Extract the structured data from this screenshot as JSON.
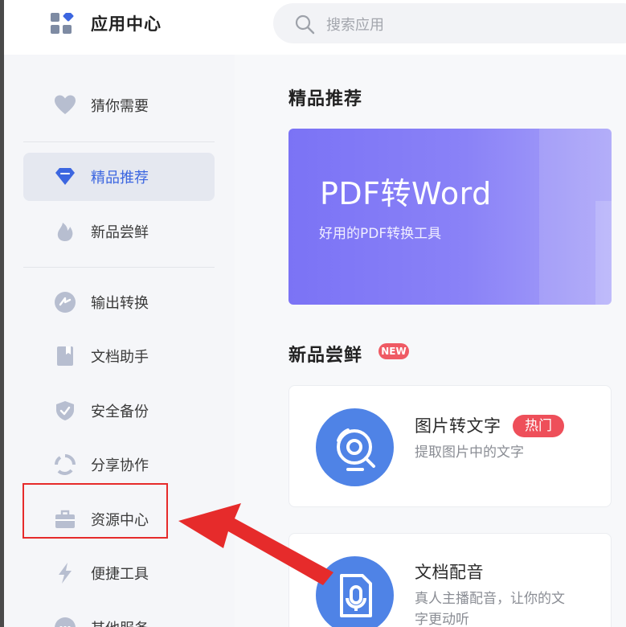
{
  "header": {
    "title": "应用中心",
    "search_placeholder": "搜索应用"
  },
  "sidebar": {
    "items": [
      {
        "label": "猜你需要",
        "icon": "heart-icon"
      },
      {
        "label": "精品推荐",
        "icon": "diamond-icon",
        "active": true
      },
      {
        "label": "新品尝鲜",
        "icon": "flame-icon"
      },
      {
        "label": "输出转换",
        "icon": "convert-icon"
      },
      {
        "label": "文档助手",
        "icon": "document-icon"
      },
      {
        "label": "安全备份",
        "icon": "shield-icon"
      },
      {
        "label": "分享协作",
        "icon": "share-cycle-icon"
      },
      {
        "label": "资源中心",
        "icon": "briefcase-icon"
      },
      {
        "label": "便捷工具",
        "icon": "lightning-icon"
      },
      {
        "label": "其他服务",
        "icon": "chat-bubble-icon"
      }
    ]
  },
  "main": {
    "featured": {
      "title": "精品推荐",
      "banner_title": "PDF转Word",
      "banner_subtitle": "好用的PDF转换工具"
    },
    "new_section": {
      "title": "新品尝鲜",
      "badge": "NEW",
      "cards": [
        {
          "title": "图片转文字",
          "badge": "热门",
          "desc": "提取图片中的文字",
          "icon": "image-scan-icon"
        },
        {
          "title": "文档配音",
          "desc_line1": "真人主播配音，让你的文",
          "desc_line2": "字更动听",
          "icon": "microphone-document-icon"
        }
      ]
    }
  },
  "colors": {
    "accent": "#3c66e0",
    "banner": "#7b73f5",
    "card_icon": "#4f83e6",
    "badge_red": "#ef5a64",
    "annotation": "#e62b2b"
  }
}
